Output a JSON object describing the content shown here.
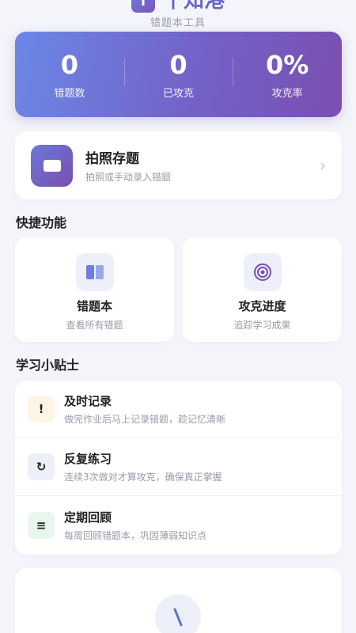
{
  "app": {
    "logo_glyph": "T",
    "name": "千知港",
    "subtitle": "错题本工具"
  },
  "stats": [
    {
      "value": "0",
      "label": "错题数"
    },
    {
      "value": "0",
      "label": "已攻克"
    },
    {
      "value": "0%",
      "label": "攻克率"
    }
  ],
  "capture": {
    "title": "拍照存题",
    "subtitle": "拍照或手动录入错题",
    "icon": "camera-icon"
  },
  "quick_section": {
    "title": "快捷功能"
  },
  "quick": [
    {
      "title": "错题本",
      "subtitle": "查看所有错题",
      "icon": "book-icon"
    },
    {
      "title": "攻克进度",
      "subtitle": "追踪学习成果",
      "icon": "target-icon"
    }
  ],
  "tips_section": {
    "title": "学习小贴士"
  },
  "tips": [
    {
      "icon_glyph": "!",
      "title": "及时记录",
      "subtitle": "做完作业后马上记录错题，趁记忆清晰",
      "icon": "exclamation-icon",
      "bg": "#fff4e5"
    },
    {
      "icon_glyph": "↻",
      "title": "反复练习",
      "subtitle": "连续3次做对才算攻克，确保真正掌握",
      "icon": "refresh-icon",
      "bg": "#eef0f9"
    },
    {
      "icon_glyph": "≡",
      "title": "定期回顾",
      "subtitle": "每周回顾错题本，巩固薄弱知识点",
      "icon": "list-icon",
      "bg": "#e8f6ee"
    }
  ],
  "colors": {
    "accent": "#6a64c8",
    "gradient_start": "#6b87e6",
    "gradient_end": "#7a4fb0",
    "background": "#f4f5fa"
  }
}
